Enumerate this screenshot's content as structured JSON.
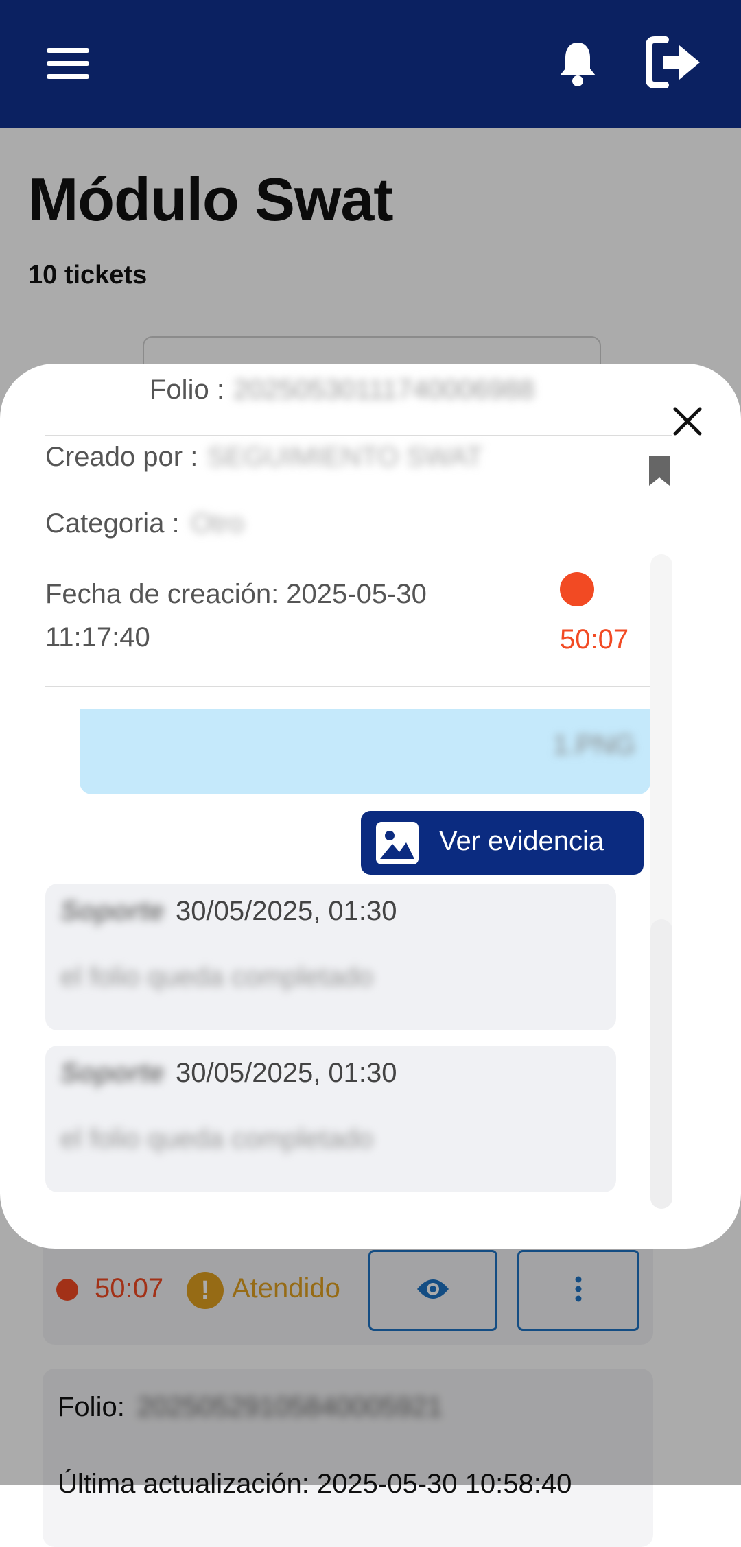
{
  "colors": {
    "header": "#0b2161",
    "accent": "#0b2b80",
    "alert": "#f24a23",
    "warning": "#e0a020",
    "bubble": "#c5e9fb"
  },
  "header": {
    "menu_icon": "hamburger-menu-icon",
    "bell_icon": "bell-icon",
    "logout_icon": "logout-icon"
  },
  "page": {
    "title": "Módulo Swat",
    "ticket_count": "10 tickets"
  },
  "list": {
    "card1": {
      "timer": "50:07",
      "status": "Atendido",
      "view_icon": "eye-icon",
      "more_icon": "more-vertical-icon"
    },
    "card2": {
      "folio_label": "Folio:",
      "folio_value": "20250529105840005921",
      "updated_label": "Última actualización: 2025-05-30 10:58:40"
    }
  },
  "modal": {
    "folio_label": "Folio :",
    "folio_value": "20250530111740006988",
    "created_by_label": "Creado por :",
    "created_by_value": "SEGUIMIENTO SWAT",
    "category_label": "Categoria :",
    "category_value": "Otro",
    "created_date_label": "Fecha de creación: 2025-05-30",
    "created_time": "11:17:40",
    "timer": "50:07",
    "close_icon": "close-icon",
    "bookmark_icon": "bookmark-icon",
    "attachment_name": "1.PNG",
    "evidence_button": "Ver evidencia",
    "evidence_icon": "image-icon",
    "messages": [
      {
        "author": "Soporte",
        "date": "30/05/2025, 01:30",
        "text": "el folio queda completado"
      },
      {
        "author": "Soporte",
        "date": "30/05/2025, 01:30",
        "text": "el folio queda completado"
      }
    ]
  }
}
